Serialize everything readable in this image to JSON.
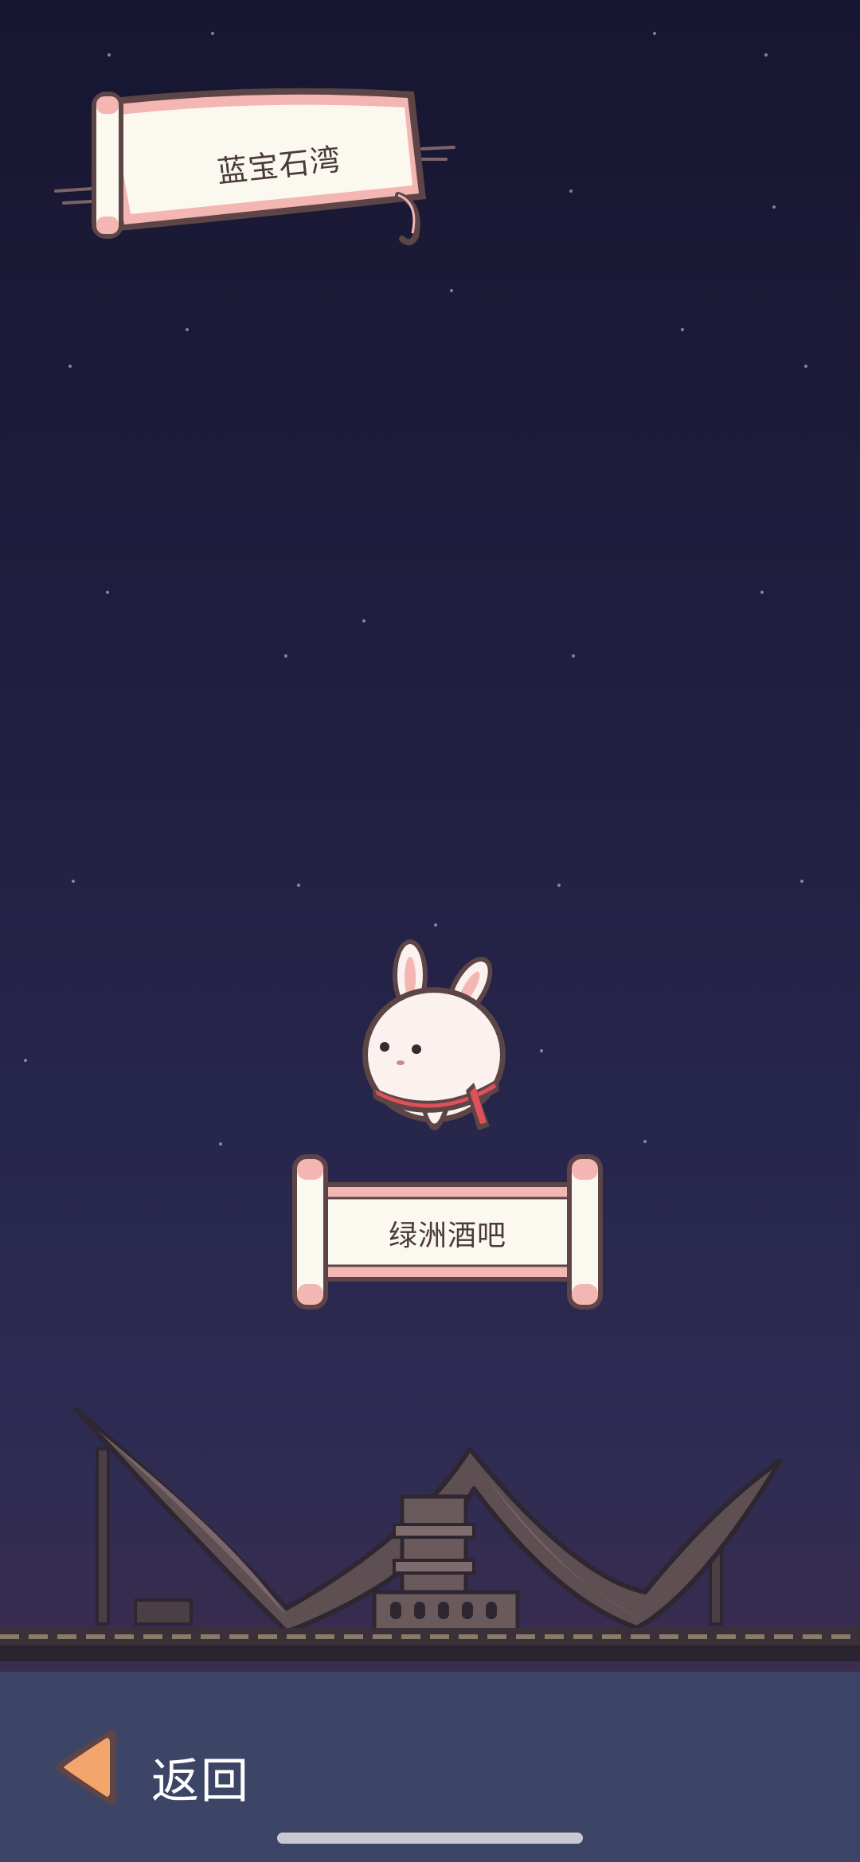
{
  "region_banner": {
    "title": "蓝宝石湾"
  },
  "location": {
    "name": "绿洲酒吧"
  },
  "character": {
    "icon": "bunny-icon"
  },
  "navigation": {
    "back_label": "返回",
    "back_icon": "left-arrow-icon"
  },
  "colors": {
    "sky_top": "#171631",
    "sky_bottom": "#2d2b53",
    "scroll_paper": "#fbf8f0",
    "scroll_trim": "#f3b6b2",
    "outline": "#5c4447",
    "bottom_bar": "#3d4566",
    "arrow": "#f3a56b"
  }
}
